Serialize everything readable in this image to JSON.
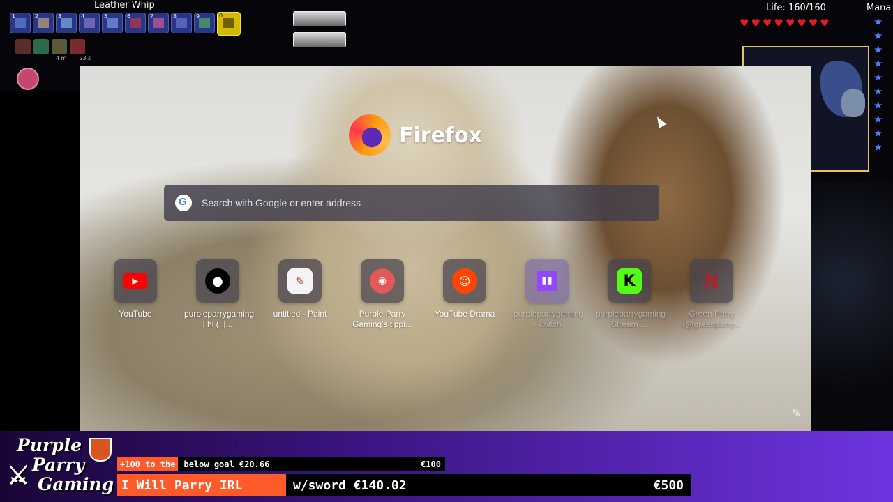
{
  "game_hud": {
    "selected_item_name": "Leather Whip",
    "hotbar_slots": [
      "1",
      "2",
      "3",
      "4",
      "5",
      "6",
      "7",
      "8",
      "9",
      "0"
    ],
    "selected_slot_index": 9,
    "buff_times": [
      "4 m",
      "23 s"
    ],
    "life_label": "Life: 160/160",
    "mana_label": "Mana",
    "hearts_count": 8,
    "mana_stars_count": 10
  },
  "browser": {
    "brand_name": "Firefox",
    "search": {
      "placeholder": "Search with Google or enter address",
      "value": ""
    },
    "shortcuts": [
      {
        "label": "YouTube",
        "icon": "youtube-icon",
        "color": "#ff0000",
        "faded": false
      },
      {
        "label": "purpleparrygaming | hi (: |...",
        "icon": "patreon-icon",
        "color": "#000000",
        "faded": false
      },
      {
        "label": "untitled - Paint",
        "icon": "paint-icon",
        "color": "#ffffff",
        "faded": false
      },
      {
        "label": "Purple Parry Gaming's tippi...",
        "icon": "tipping-icon",
        "color": "#e05a5a",
        "faded": false
      },
      {
        "label": "YouTube Drama",
        "icon": "reddit-icon",
        "color": "#ff4500",
        "faded": false
      },
      {
        "label": "purpleparrygaming - Twitch",
        "icon": "twitch-icon",
        "color": "#9146ff",
        "faded": true
      },
      {
        "label": "purpleparrygaming Stream ...",
        "icon": "kick-icon",
        "color": "#53fc18",
        "faded": true
      },
      {
        "label": "Green Parry (@greenparry...",
        "icon": "n-icon",
        "color": "#e50914",
        "faded": true
      }
    ]
  },
  "overlay": {
    "logo_lines": [
      "Purple",
      "Parry",
      "Gaming"
    ],
    "ticker_highlight": "+100 to the",
    "ticker_text": "below goal €20.66",
    "ticker_amount": "€100",
    "goal_title": "I Will Parry IRL",
    "goal_current": "w/sword €140.02",
    "goal_target": "€500",
    "goal_progress": 0.28,
    "accent_color": "#ff5a2a"
  }
}
